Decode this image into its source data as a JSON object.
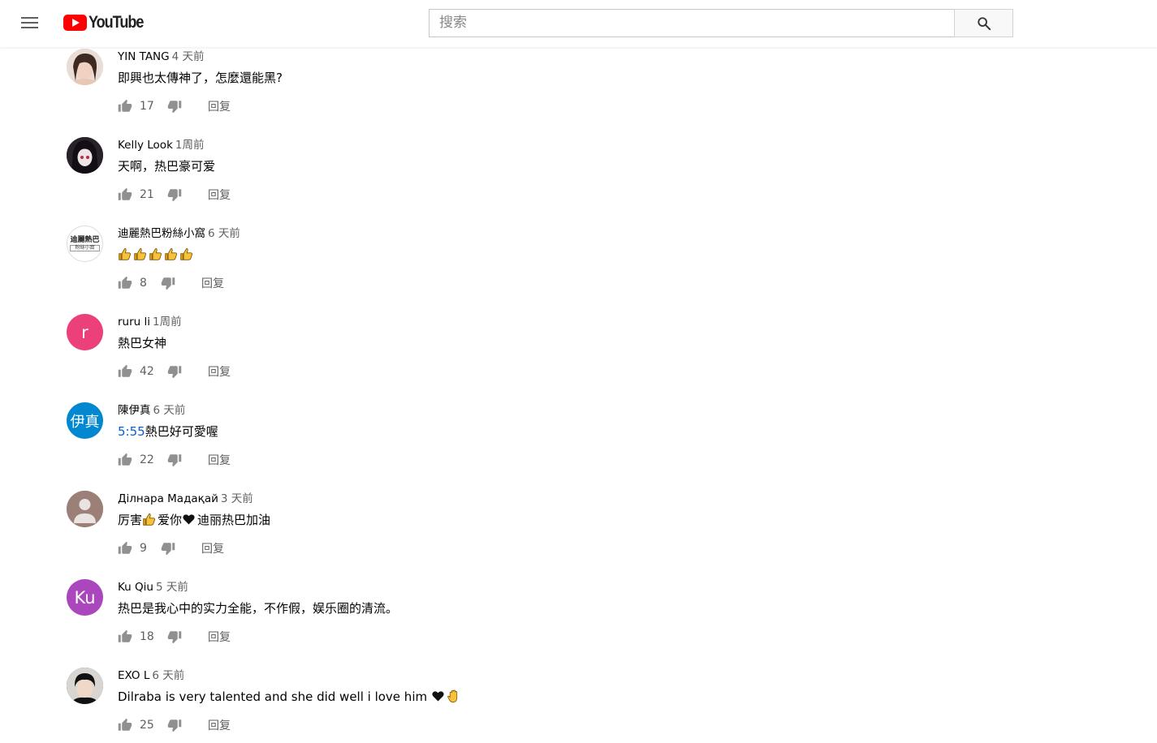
{
  "header": {
    "logo_text": "YouTube",
    "search_placeholder": "搜索",
    "menu_icon": "hamburger-menu-icon",
    "search_icon": "search-icon"
  },
  "colors": {
    "brand_red": "#ff0000",
    "link_blue": "#065fd4",
    "secondary_text": "#606060"
  },
  "comments": [
    {
      "author": "YIN TANG",
      "time": "4 天前",
      "text": "即興也太傳神了，怎麼還能黑?",
      "likes": "17",
      "reply": "回复"
    },
    {
      "author": "Kelly Look",
      "time": "1周前",
      "text": "天啊，热巴豪可爱",
      "likes": "21",
      "reply": "回复"
    },
    {
      "author": "迪麗熱巴粉絲小窩",
      "time": "6 天前",
      "text": "",
      "emoji_count": 5,
      "likes": "8",
      "reply": "回复",
      "avatar_text_1": "迪麗熱巴",
      "avatar_text_2": "粉絲小窩"
    },
    {
      "author": "ruru li",
      "time": "1周前",
      "text": "熱巴女神",
      "likes": "42",
      "reply": "回复",
      "avatar_letter": "r",
      "avatar_color": "#ec407a"
    },
    {
      "author": "陳伊真",
      "time": "6 天前",
      "timestamp_link": "5:55",
      "text": "熱巴好可愛喔",
      "likes": "22",
      "reply": "回复",
      "avatar_letter": "伊真",
      "avatar_color": "#0288d1"
    },
    {
      "author": "Дiлнара Мадақай",
      "time": "3 天前",
      "text_parts": [
        "厉害",
        "爱你",
        "迪丽热巴加油"
      ],
      "likes": "9",
      "reply": "回复"
    },
    {
      "author": "Ku Qiu",
      "time": "5 天前",
      "text": "热巴是我心中的实力全能，不作假，娱乐圈的清流。",
      "likes": "18",
      "reply": "回复",
      "avatar_letter": "Ku",
      "avatar_color": "#ab47bc"
    },
    {
      "author": "EXO L",
      "time": "6 天前",
      "text": "Dilraba is very talented and she did well i love him ",
      "likes": "25",
      "reply": "回复"
    }
  ]
}
